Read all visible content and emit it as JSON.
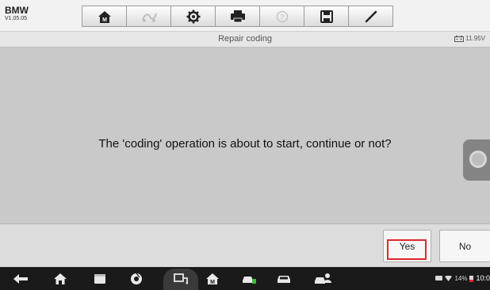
{
  "header": {
    "brand": "BMW",
    "version": "V1.05.05",
    "toolbar_icons": [
      "home-icon",
      "vehicle-swap-icon",
      "gear-icon",
      "printer-icon",
      "help-icon",
      "save-icon",
      "pen-icon"
    ]
  },
  "titlebar": {
    "title": "Repair coding",
    "battery_voltage": "11.95V"
  },
  "dialog": {
    "message": "The 'coding' operation is about to start, continue or not?"
  },
  "footer": {
    "yes_label": "Yes",
    "no_label": "No"
  },
  "navbar": {
    "icons": [
      "back-icon",
      "home-icon",
      "recents-icon",
      "browser-icon",
      "vci-connect-icon",
      "autel-home-icon",
      "car-service-icon",
      "car-icon",
      "car-user-icon"
    ],
    "status": {
      "battery": "14%",
      "time": "10:0"
    }
  },
  "colors": {
    "highlight": "#e0282f",
    "content_bg": "#c9c9c9"
  }
}
